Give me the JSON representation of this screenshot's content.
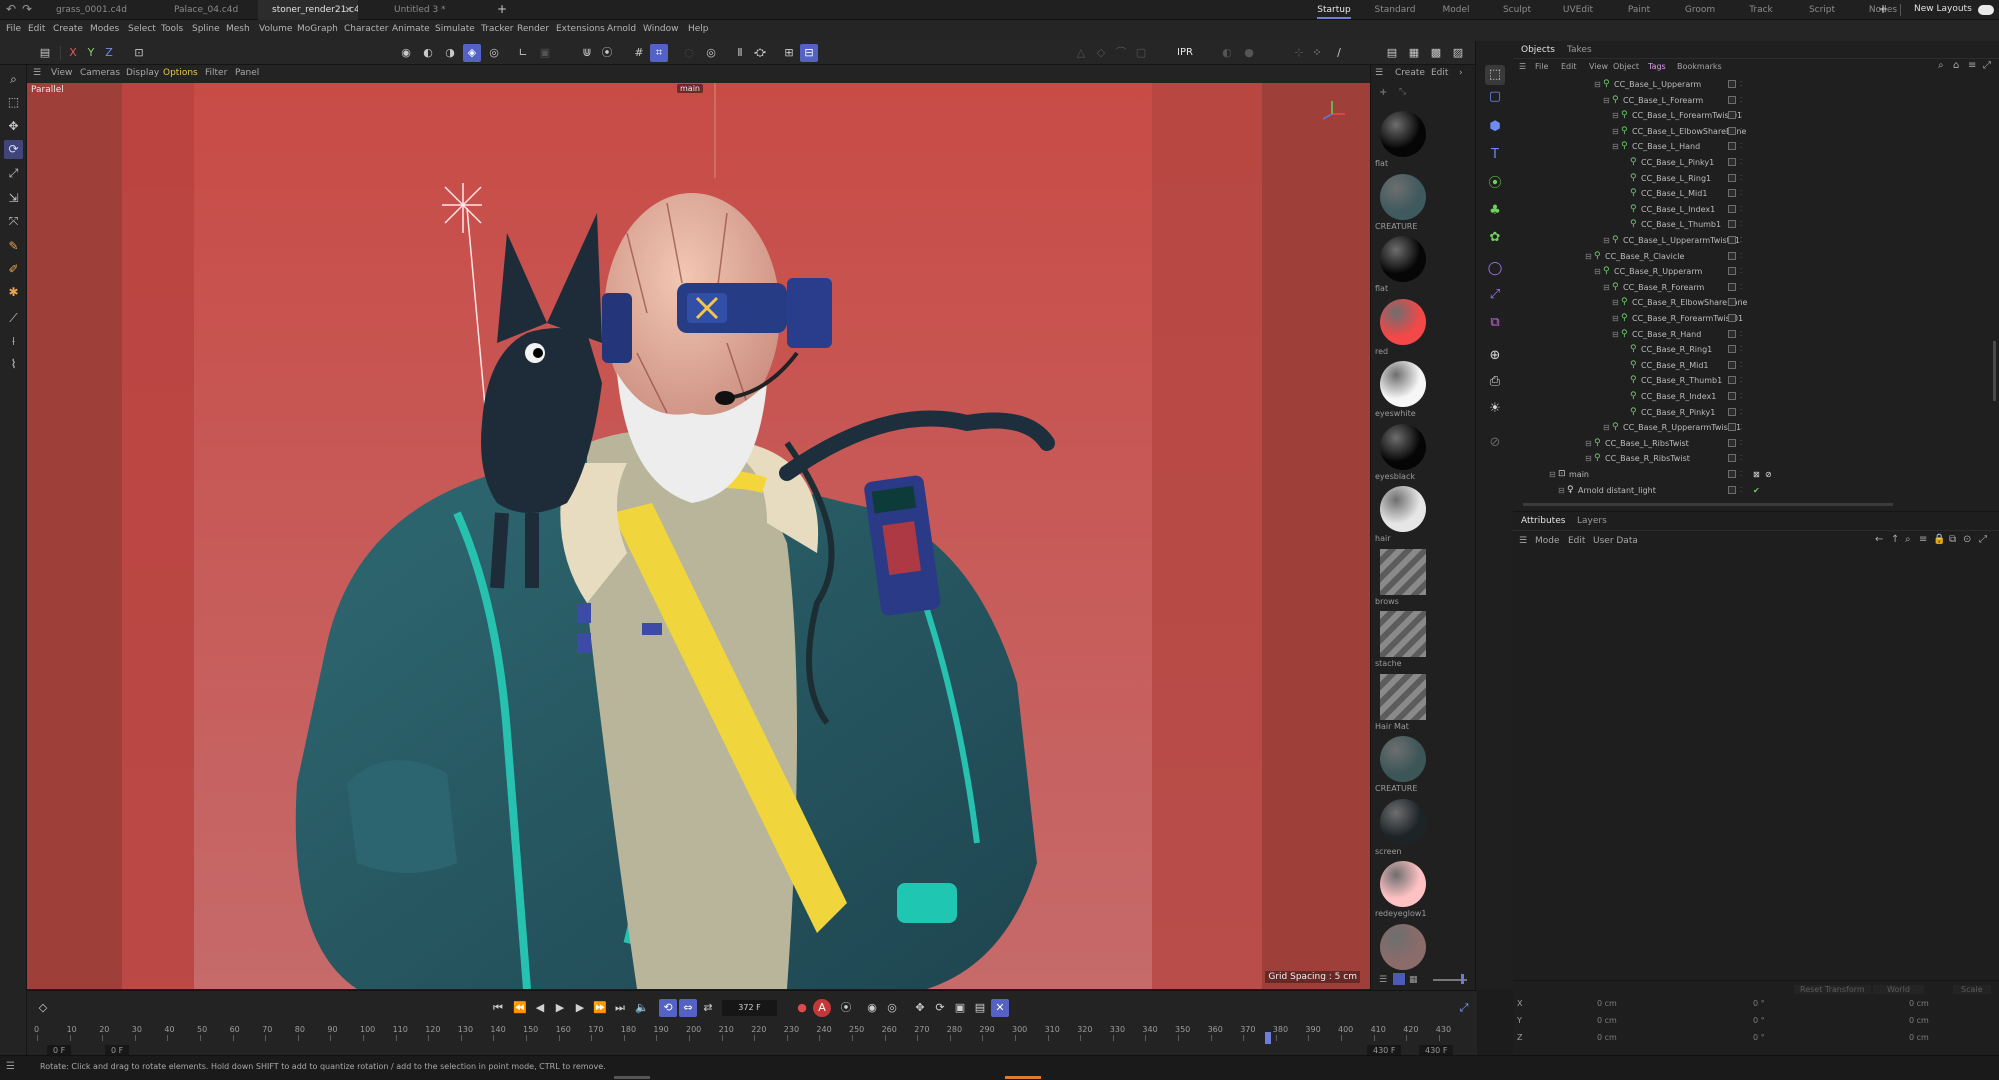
{
  "tabs": {
    "documents": [
      "grass_0001.c4d *",
      "Palace_04.c4d",
      "stoner_render21.c4d *",
      "Untitled 3 *"
    ],
    "active_document": "stoner_render21.c4d *",
    "close_glyph": "×",
    "add_glyph": "+",
    "layouts": [
      "Startup",
      "Standard",
      "Model",
      "Sculpt",
      "UVEdit",
      "Paint",
      "Groom",
      "Track",
      "Script",
      "Nodes"
    ],
    "active_layout": "Startup",
    "new_layouts": "New Layouts"
  },
  "menu": [
    "File",
    "Edit",
    "Create",
    "Modes",
    "Select",
    "Tools",
    "Spline",
    "Mesh",
    "Volume",
    "MoGraph",
    "Character",
    "Animate",
    "Simulate",
    "Tracker",
    "Render",
    "Extensions",
    "Arnold",
    "Window",
    "Help"
  ],
  "toolbar": {
    "axis_labels": [
      "X",
      "Y",
      "Z"
    ],
    "ipr_label": "IPR"
  },
  "viewport": {
    "menu": [
      "View",
      "Cameras",
      "Display",
      "Options",
      "Filter",
      "Panel"
    ],
    "active_menu": "Options",
    "projection": "Parallel",
    "camera_tag": "main",
    "grid_spacing": "Grid Spacing : 5 cm"
  },
  "materials": {
    "header": [
      "Create",
      "Edit"
    ],
    "items": [
      {
        "name": "flat",
        "color": "#050505",
        "kind": "ball"
      },
      {
        "name": "CREATURE",
        "color": "#3f5a5e",
        "kind": "ball"
      },
      {
        "name": "flat",
        "color": "#060606",
        "kind": "ball"
      },
      {
        "name": "red",
        "color": "#f24848",
        "kind": "ball"
      },
      {
        "name": "eyeswhite",
        "color": "#f6f6f6",
        "kind": "ball"
      },
      {
        "name": "eyesblack",
        "color": "#050505",
        "kind": "ball"
      },
      {
        "name": "hair",
        "color": "#e6e6e6",
        "kind": "ball"
      },
      {
        "name": "brows",
        "color": "#808080",
        "kind": "tile"
      },
      {
        "name": "stache",
        "color": "#808080",
        "kind": "tile"
      },
      {
        "name": "Hair Mat",
        "color": "#808080",
        "kind": "tile"
      },
      {
        "name": "CREATURE",
        "color": "#3c5658",
        "kind": "ball"
      },
      {
        "name": "screen",
        "color": "#1d2427",
        "kind": "ball"
      },
      {
        "name": "redeyeglow1",
        "color": "#ffc2c4",
        "kind": "ball"
      },
      {
        "name": "",
        "color": "#8a6c6a",
        "kind": "ball"
      }
    ]
  },
  "objects": {
    "tabs": [
      "Objects",
      "Takes"
    ],
    "menu": [
      "File",
      "Edit",
      "View",
      "Object",
      "Tags",
      "Bookmarks"
    ],
    "rows": [
      {
        "label": "CC_Base_L_Upperarm",
        "indent": 5
      },
      {
        "label": "CC_Base_L_Forearm",
        "indent": 6
      },
      {
        "label": "CC_Base_L_ForearmTwist01",
        "indent": 7
      },
      {
        "label": "CC_Base_L_ElbowShareBone",
        "indent": 7
      },
      {
        "label": "CC_Base_L_Hand",
        "indent": 7
      },
      {
        "label": "CC_Base_L_Pinky1",
        "indent": 8
      },
      {
        "label": "CC_Base_L_Ring1",
        "indent": 8
      },
      {
        "label": "CC_Base_L_Mid1",
        "indent": 8
      },
      {
        "label": "CC_Base_L_Index1",
        "indent": 8
      },
      {
        "label": "CC_Base_L_Thumb1",
        "indent": 8
      },
      {
        "label": "CC_Base_L_UpperarmTwist01",
        "indent": 6
      },
      {
        "label": "CC_Base_R_Clavicle",
        "indent": 4
      },
      {
        "label": "CC_Base_R_Upperarm",
        "indent": 5
      },
      {
        "label": "CC_Base_R_Forearm",
        "indent": 6
      },
      {
        "label": "CC_Base_R_ElbowShareBone",
        "indent": 7
      },
      {
        "label": "CC_Base_R_ForearmTwist01",
        "indent": 7
      },
      {
        "label": "CC_Base_R_Hand",
        "indent": 7
      },
      {
        "label": "CC_Base_R_Ring1",
        "indent": 8
      },
      {
        "label": "CC_Base_R_Mid1",
        "indent": 8
      },
      {
        "label": "CC_Base_R_Thumb1",
        "indent": 8
      },
      {
        "label": "CC_Base_R_Index1",
        "indent": 8
      },
      {
        "label": "CC_Base_R_Pinky1",
        "indent": 8
      },
      {
        "label": "CC_Base_R_UpperarmTwist01",
        "indent": 6
      },
      {
        "label": "CC_Base_L_RibsTwist",
        "indent": 4
      },
      {
        "label": "CC_Base_R_RibsTwist",
        "indent": 4
      },
      {
        "label": "main",
        "indent": 0
      },
      {
        "label": "Arnold distant_light",
        "indent": 1
      }
    ]
  },
  "attributes": {
    "tabs": [
      "Attributes",
      "Layers"
    ],
    "menu": [
      "Mode",
      "Edit",
      "User Data"
    ]
  },
  "coordinates": {
    "buttons": [
      "Reset Transform",
      "World",
      "Scale"
    ],
    "rows": [
      {
        "axis": "X",
        "pos": "0 cm",
        "rot": "0 °",
        "size": "0 cm"
      },
      {
        "axis": "Y",
        "pos": "0 cm",
        "rot": "0 °",
        "size": "0 cm"
      },
      {
        "axis": "Z",
        "pos": "0 cm",
        "rot": "0 °",
        "size": "0 cm"
      }
    ]
  },
  "timeline": {
    "current_frame": "372 F",
    "ruler_labels": [
      "0",
      "10",
      "20",
      "30",
      "40",
      "50",
      "60",
      "70",
      "80",
      "90",
      "100",
      "110",
      "120",
      "130",
      "140",
      "150",
      "160",
      "170",
      "180",
      "190",
      "200",
      "210",
      "220",
      "230",
      "240",
      "250",
      "260",
      "270",
      "280",
      "290",
      "300",
      "310",
      "320",
      "330",
      "340",
      "350",
      "360",
      "370",
      "380",
      "390",
      "400",
      "410",
      "420",
      "430"
    ],
    "start_field": "0 F",
    "start_field_b": "0 F",
    "end_field": "430 F",
    "end_field_b": "430 F"
  },
  "status": "Rotate: Click and drag to rotate elements. Hold down SHIFT to add to quantize rotation / add to the selection in point mode, CTRL to remove."
}
